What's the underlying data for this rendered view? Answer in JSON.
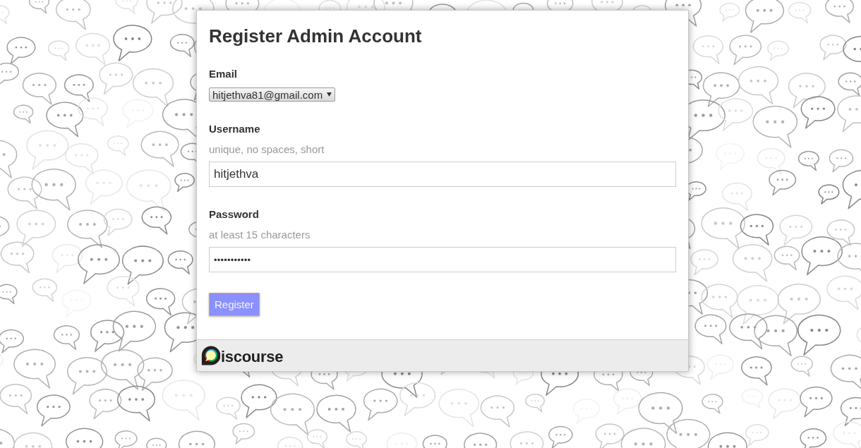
{
  "card": {
    "title": "Register Admin Account"
  },
  "fields": [
    {
      "kind": "select",
      "label": "Email",
      "value": "hitjethva81@gmail.com"
    },
    {
      "kind": "text",
      "label": "Username",
      "hint": "unique, no spaces, short",
      "value": "hitjethva"
    },
    {
      "kind": "password",
      "label": "Password",
      "hint": "at least 15 characters",
      "value": "•••••••••••"
    }
  ],
  "submit_button": {
    "label": "Register"
  },
  "footer": {
    "logo_text": "iscourse"
  }
}
